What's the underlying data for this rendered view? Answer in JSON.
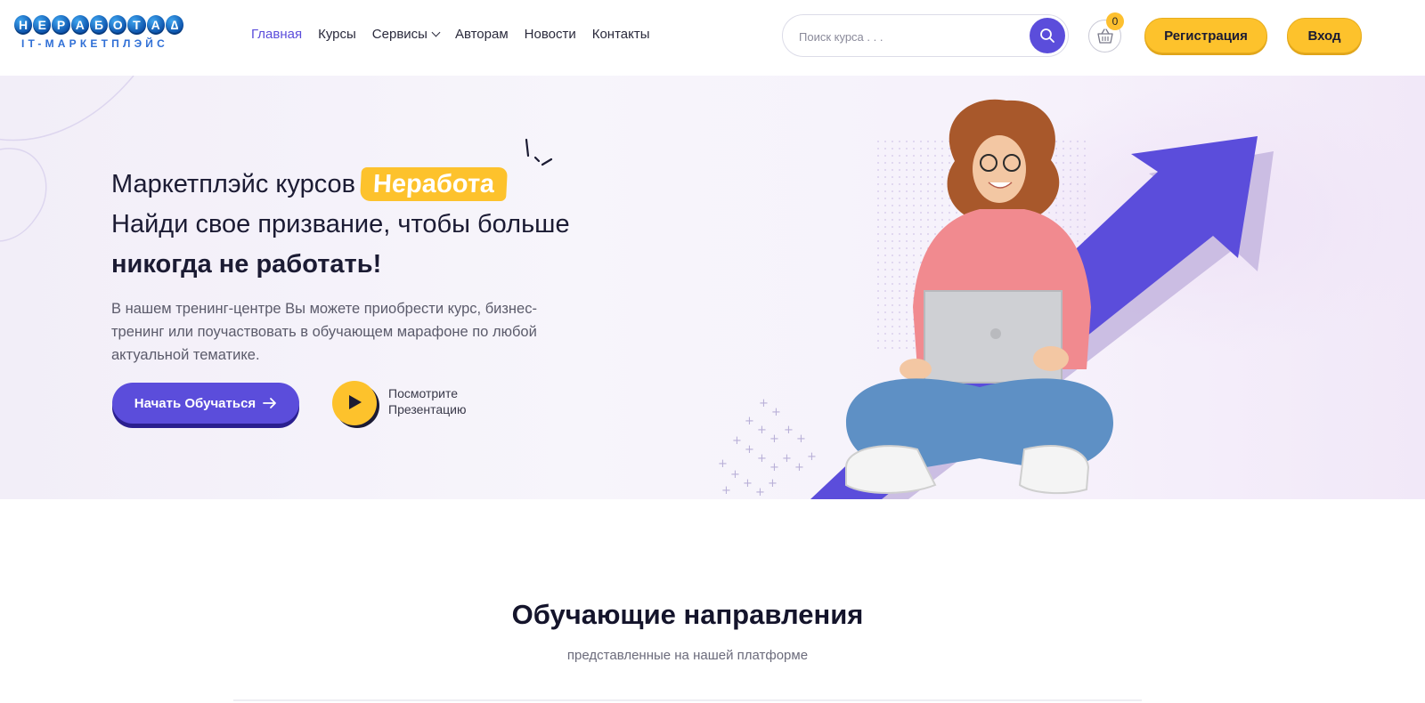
{
  "logo": {
    "letters": [
      "Н",
      "Е",
      "Р",
      "А",
      "Б",
      "О",
      "Т",
      "А",
      "∆"
    ],
    "subtitle": "IT-МАРКЕТПЛЭЙС"
  },
  "nav": {
    "items": [
      {
        "label": "Главная",
        "active": true
      },
      {
        "label": "Курсы"
      },
      {
        "label": "Сервисы",
        "has_dropdown": true
      },
      {
        "label": "Авторам"
      },
      {
        "label": "Новости"
      },
      {
        "label": "Контакты"
      }
    ]
  },
  "search": {
    "placeholder": "Поиск курса . . .",
    "icon": "search-icon"
  },
  "cart": {
    "count": "0",
    "icon": "basket-icon"
  },
  "auth": {
    "register_label": "Регистрация",
    "login_label": "Вход"
  },
  "hero": {
    "line1": "Маркетплэйс курсов",
    "highlight": "Неработа",
    "line2": "Найди свое призвание, чтобы больше",
    "line3": "никогда не работать!",
    "description": "В нашем тренинг-центре Вы можете приобрести курс, бизнес-тренинг или поучаствовать в обучающем марафоне по любой актуальной тематике.",
    "cta_label": "Начать Обучаться",
    "watch_line1": "Посмотрите",
    "watch_line2": "Презентацию"
  },
  "section": {
    "title": "Обучающие направления",
    "subtitle": "представленные на нашей платформе"
  },
  "colors": {
    "accent": "#5b4ddb",
    "yellow": "#fdc22c",
    "text_dark": "#1b1b33",
    "hero_bg": "#f4f1f9"
  }
}
